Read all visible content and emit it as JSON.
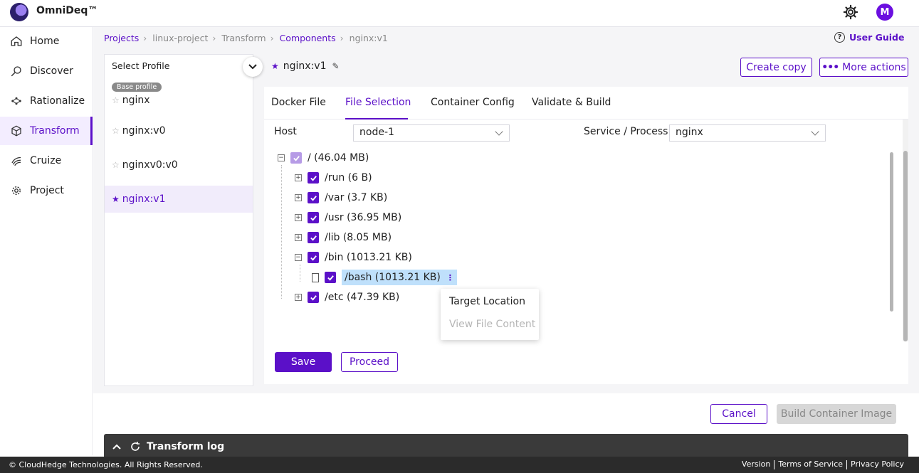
{
  "app": {
    "brand": "OmniDeq™",
    "user_initial": "M"
  },
  "sidebar": {
    "items": [
      {
        "label": "Home",
        "icon": "home-icon"
      },
      {
        "label": "Discover",
        "icon": "discover-icon"
      },
      {
        "label": "Rationalize",
        "icon": "rationalize-icon"
      },
      {
        "label": "Transform",
        "icon": "transform-icon"
      },
      {
        "label": "Cruize",
        "icon": "cruize-icon"
      },
      {
        "label": "Project",
        "icon": "gear-icon"
      }
    ],
    "active": "Transform"
  },
  "breadcrumb": [
    "Projects",
    "linux-project",
    "Transform",
    "Components",
    "nginx:v1"
  ],
  "user_guide": "User Guide",
  "profiles": {
    "header": "Select Profile",
    "base_badge": "Base profile",
    "items": [
      "nginx",
      "nginx:v0",
      "nginxv0:v0",
      "nginx:v1"
    ],
    "active": "nginx:v1"
  },
  "component": {
    "name": "nginx:v1",
    "create_copy": "Create copy",
    "more_actions": "More actions"
  },
  "tabs": [
    "Docker File",
    "File Selection",
    "Container Config",
    "Validate & Build"
  ],
  "active_tab": "File Selection",
  "host": {
    "label": "Host",
    "value": "node-1"
  },
  "service": {
    "label": "Service / Process",
    "value": "nginx"
  },
  "tree": {
    "root": "/ (46.04 MB)",
    "children": [
      "/run (6 B)",
      "/var (3.7 KB)",
      "/usr (36.95 MB)",
      "/lib (8.05 MB)",
      "/bin (1013.21 KB)"
    ],
    "bin_child": "/bash (1013.21 KB)",
    "last": "/etc (47.39 KB)"
  },
  "context_menu": {
    "target_location": "Target Location",
    "view_file_content": "View File Content"
  },
  "actions": {
    "save": "Save",
    "proceed": "Proceed",
    "cancel": "Cancel",
    "build": "Build Container Image"
  },
  "log": {
    "title": "Transform log"
  },
  "footer": {
    "copyright": "© CloudHedge Technologies. All Rights Reserved.",
    "version": "Version",
    "terms": "Terms of Service",
    "privacy": "Privacy Policy"
  },
  "colors": {
    "accent": "#5b10c8",
    "highlight": "#bfe0fb"
  }
}
